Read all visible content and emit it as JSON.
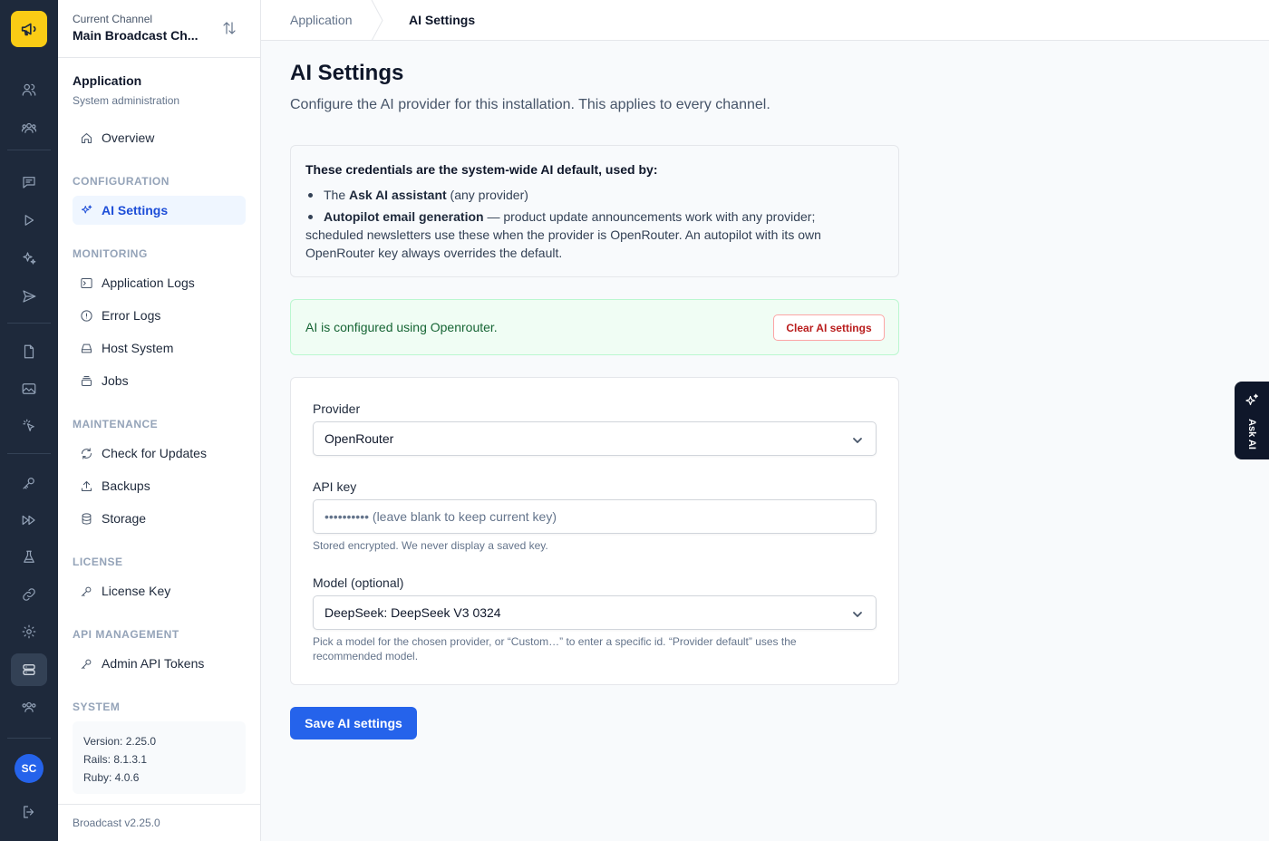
{
  "channel": {
    "label": "Current Channel",
    "name": "Main Broadcast Ch..."
  },
  "sidebar": {
    "title": "Application",
    "subtitle": "System administration",
    "overview": "Overview",
    "sections": {
      "configuration": "CONFIGURATION",
      "monitoring": "MONITORING",
      "maintenance": "MAINTENANCE",
      "license": "LICENSE",
      "api_management": "API MANAGEMENT",
      "system": "SYSTEM"
    },
    "items": {
      "ai_settings": "AI Settings",
      "application_logs": "Application Logs",
      "error_logs": "Error Logs",
      "host_system": "Host System",
      "jobs": "Jobs",
      "check_updates": "Check for Updates",
      "backups": "Backups",
      "storage": "Storage",
      "license_key": "License Key",
      "admin_api_tokens": "Admin API Tokens"
    },
    "system": {
      "version": "Version: 2.25.0",
      "rails": "Rails: 8.1.3.1",
      "ruby": "Ruby: 4.0.6"
    },
    "footer": "Broadcast v2.25.0"
  },
  "breadcrumb": {
    "parent": "Application",
    "current": "AI Settings"
  },
  "page": {
    "title": "AI Settings",
    "description": "Configure the AI provider for this installation. This applies to every channel."
  },
  "info": {
    "title": "These credentials are the system-wide AI default, used by:",
    "item1_prefix": "The ",
    "item1_bold": "Ask AI assistant",
    "item1_suffix": " (any provider)",
    "item2_bold": "Autopilot email generation",
    "item2_line1": " — product update announcements work with any provider;",
    "item2_line2": "scheduled newsletters use these when the provider is OpenRouter. An autopilot with its own",
    "item2_line3": "OpenRouter key always overrides the default."
  },
  "status": {
    "message": "AI is configured using Openrouter.",
    "clear_label": "Clear AI settings"
  },
  "form": {
    "provider_label": "Provider",
    "provider_value": "OpenRouter",
    "apikey_label": "API key",
    "apikey_placeholder": "•••••••••• (leave blank to keep current key)",
    "apikey_help": "Stored encrypted. We never display a saved key.",
    "model_label": "Model (optional)",
    "model_value": "DeepSeek: DeepSeek V3 0324",
    "model_help": "Pick a model for the chosen provider, or “Custom…” to enter a specific id. “Provider default” uses the recommended model.",
    "save_label": "Save AI settings"
  },
  "avatar": "SC",
  "ask_ai": "Ask AI",
  "colors": {
    "primary": "#2563eb",
    "rail": "#1e293b",
    "logo": "#facc15",
    "success_bg": "#f0fdf4",
    "danger": "#b91c1c"
  }
}
